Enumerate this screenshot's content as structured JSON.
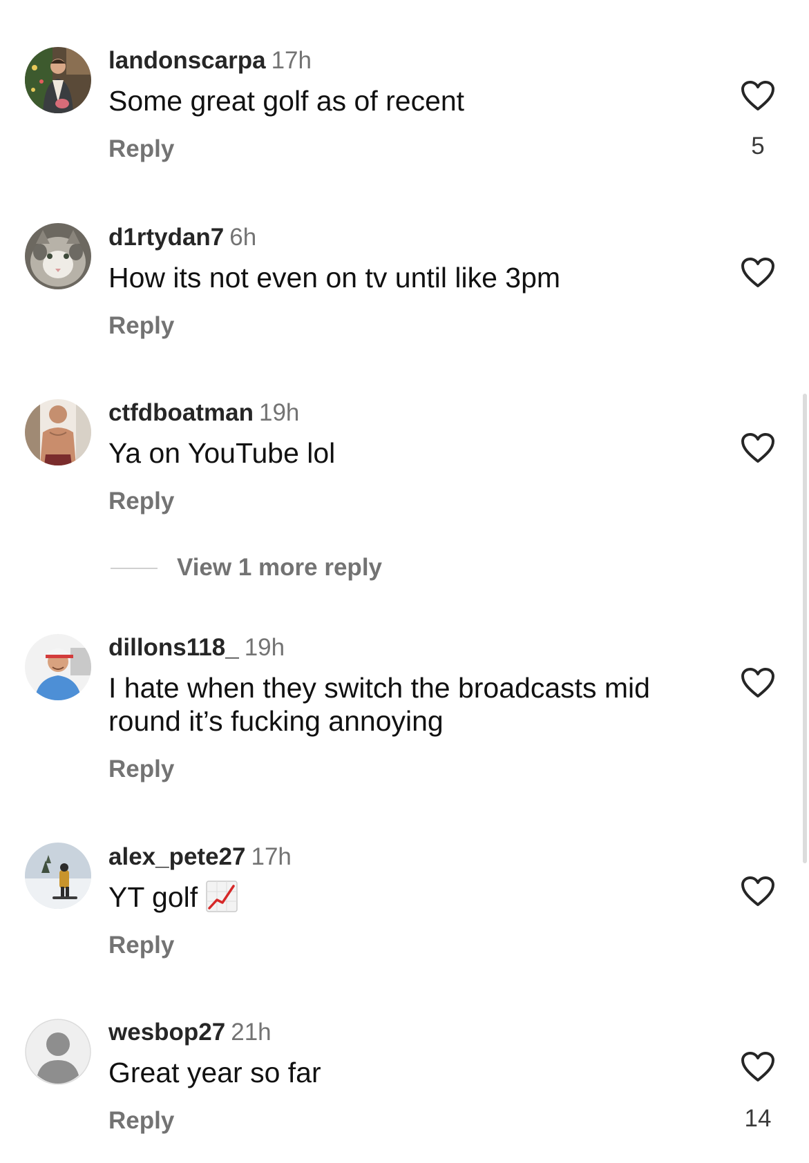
{
  "comments": [
    {
      "username": "landonscarpa",
      "time": "17h",
      "text": "Some great golf as of recent",
      "reply_label": "Reply",
      "like_count": "5",
      "avatar": "photo-avatar-man-indoor"
    },
    {
      "username": "d1rtydan7",
      "time": "6h",
      "text": "How its not even on tv until like 3pm",
      "reply_label": "Reply",
      "like_count": "",
      "avatar": "photo-avatar-cat"
    },
    {
      "username": "ctfdboatman",
      "time": "19h",
      "text": "Ya on YouTube lol",
      "reply_label": "Reply",
      "like_count": "",
      "avatar": "photo-avatar-man-shirtless",
      "view_more_label": "View 1 more reply"
    },
    {
      "username": "dillons118_",
      "time": "19h",
      "text": "I hate when they switch the broadcasts mid round it’s fucking annoying",
      "reply_label": "Reply",
      "like_count": "",
      "avatar": "photo-avatar-man-cap"
    },
    {
      "username": "alex_pete27",
      "time": "17h",
      "text": "YT golf",
      "text_emoji": "chart-increasing-emoji",
      "reply_label": "Reply",
      "like_count": "",
      "avatar": "photo-avatar-snowboarder"
    },
    {
      "username": "wesbop27",
      "time": "21h",
      "text": "Great year so far",
      "reply_label": "Reply",
      "like_count": "14",
      "avatar": "default-user-icon"
    }
  ],
  "colors": {
    "username": "#262626",
    "muted": "#737373",
    "text": "#111111",
    "heart_stroke": "#262626",
    "emoji_line": "#d62828"
  },
  "icons": {
    "like": "heart-outline-icon"
  }
}
